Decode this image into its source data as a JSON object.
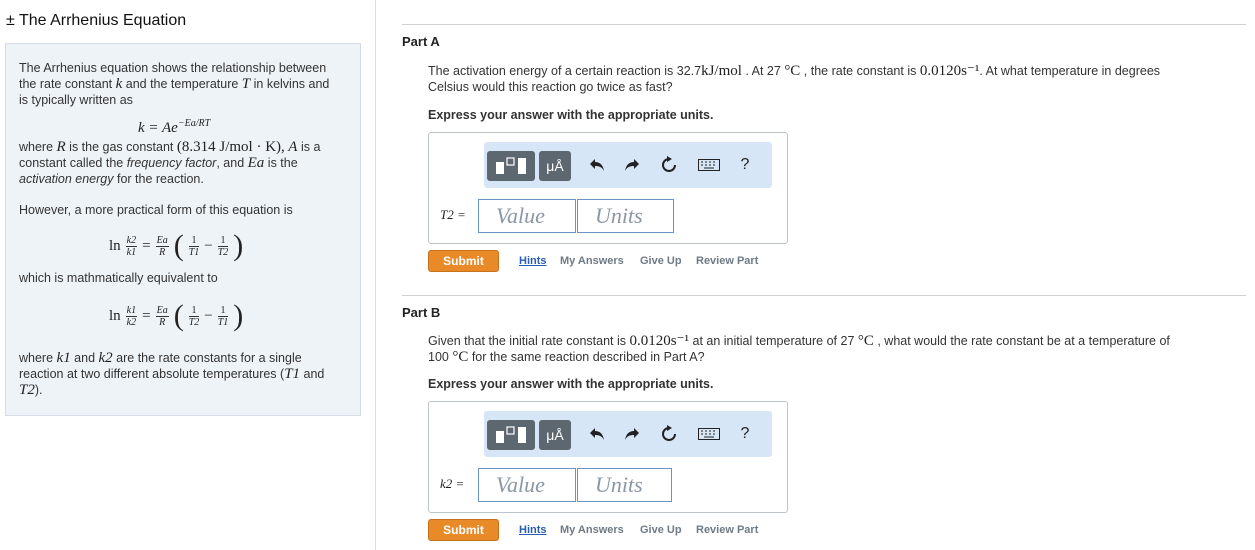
{
  "left": {
    "title": "± The Arrhenius Equation",
    "intro_line1": "The Arrhenius equation shows the relationship between",
    "intro_line2a": "the rate constant ",
    "intro_k": "k",
    "intro_line2b": " and the temperature ",
    "intro_T": "T",
    "intro_line2c": " in kelvins and",
    "intro_line3": "is typically written as",
    "eq_main_lhs": "k = Ae",
    "eq_main_exp": "−Ea/RT",
    "where_line1a": "where ",
    "where_R": "R",
    "where_line1b": " is the gas constant ",
    "where_R_value": "(8.314 J/mol · K),",
    "where_A": "A",
    "where_line1c": " is a",
    "where_line2a": "constant called the ",
    "where_ff": "frequency factor",
    "where_line2b": ", and ",
    "where_Ea": "Ea",
    "where_line2c": " is the",
    "where_ae": "activation energy",
    "where_line3b": " for the reaction.",
    "practical": "However, a more practical form of this equation is",
    "equivalent": "which is mathmatically equivalent to",
    "eq1": {
      "ln": "ln",
      "k_num": "k2",
      "k_den": "k1",
      "eq": "=",
      "ea_num": "Ea",
      "ea_den": "R",
      "t1_num": "1",
      "t1_den": "T1",
      "minus": "−",
      "t2_num": "1",
      "t2_den": "T2"
    },
    "eq2": {
      "ln": "ln",
      "k_num": "k1",
      "k_den": "k2",
      "eq": "=",
      "ea_num": "Ea",
      "ea_den": "R",
      "t1_num": "1",
      "t1_den": "T2",
      "minus": "−",
      "t2_num": "1",
      "t2_den": "T1"
    },
    "final_line1a": "where ",
    "final_k1": "k1",
    "final_and": " and ",
    "final_k2": "k2",
    "final_line1b": " are the rate constants for a single",
    "final_line2a": "reaction at two different absolute temperatures (",
    "final_T1": "T1",
    "final_line2b": " and",
    "final_T2": "T2",
    "final_line3b": ")."
  },
  "partA": {
    "title": "Part A",
    "q_line1a": "The activation energy of a certain reaction is 32.7",
    "q_unit1": "kJ/mol",
    "q_line1b": " . At 27 ",
    "q_unit2": "°C",
    "q_line1c": " , the rate constant is ",
    "q_rate": "0.0120s⁻¹",
    "q_line1d": ". At what temperature in degrees",
    "q_line2": "Celsius would this reaction go twice as fast?",
    "express": "Express your answer with the appropriate units.",
    "var_label": "T2 =",
    "value_placeholder": "Value",
    "units_placeholder": "Units",
    "submit": "Submit",
    "hints": "Hints",
    "my_answers": "My Answers",
    "give_up": "Give Up",
    "review": "Review Part"
  },
  "partB": {
    "title": "Part B",
    "q_line1a": "Given that the initial rate constant is ",
    "q_rate": "0.0120s⁻¹",
    "q_line1b": " at an initial temperature of 27 ",
    "q_unit1": "°C",
    "q_line1c": " , what would the rate constant be at a temperature of",
    "q_line2a": "100 ",
    "q_unit2": "°C",
    "q_line2b": " for the same reaction described in Part A?",
    "express": "Express your answer with the appropriate units.",
    "var_label": "k2 =",
    "value_placeholder": "Value",
    "units_placeholder": "Units",
    "submit": "Submit",
    "hints": "Hints",
    "my_answers": "My Answers",
    "give_up": "Give Up",
    "review": "Review Part"
  },
  "toolbar": {
    "units_button": "μÅ",
    "help": "?",
    "icons": [
      "templates-icon",
      "units-icon",
      "undo-icon",
      "redo-icon",
      "reset-icon",
      "keyboard-icon",
      "help-icon"
    ]
  }
}
